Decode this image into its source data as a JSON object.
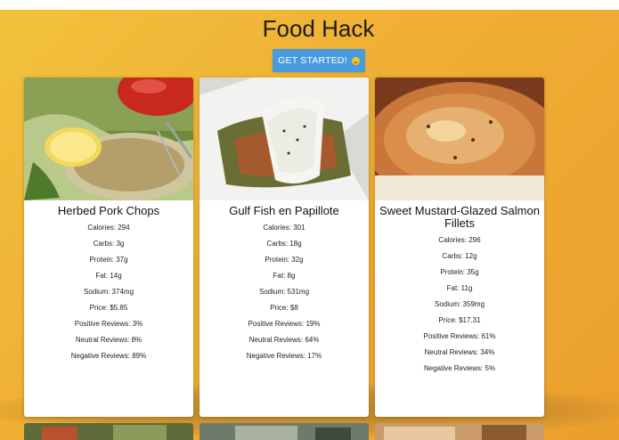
{
  "page": {
    "title": "Food Hack",
    "cta_label": "GET STARTED!",
    "cta_icon": "grinning-face-emoji"
  },
  "colors": {
    "background_start": "#f2c23e",
    "background_end": "#eb9f2e",
    "button": "#4a9bde",
    "card": "#ffffff"
  },
  "cards": [
    {
      "name": "Herbed Pork Chops",
      "image": "pork-chops-photo",
      "stats": [
        "Calories: 294",
        "Carbs: 3g",
        "Protein: 37g",
        "Fat: 14g",
        "Sodium: 374mg",
        "Price: $5.85",
        "Positive Reviews: 3%",
        "Neutral Reviews: 8%",
        "Negative Reviews: 89%"
      ]
    },
    {
      "name": "Gulf Fish en Papillote",
      "image": "fish-papillote-photo",
      "stats": [
        "Calories: 301",
        "Carbs: 18g",
        "Protein: 32g",
        "Fat: 8g",
        "Sodium: 531mg",
        "Price: $8",
        "Positive Reviews: 19%",
        "Neutral Reviews: 64%",
        "Negative Reviews: 17%"
      ]
    },
    {
      "name": "Sweet Mustard-Glazed Salmon Fillets",
      "image": "salmon-fillet-photo",
      "stats": [
        "Calories: 296",
        "Carbs: 12g",
        "Protein: 35g",
        "Fat: 11g",
        "Sodium: 359mg",
        "Price: $17.31",
        "Positive Reviews: 61%",
        "Neutral Reviews: 34%",
        "Negative Reviews: 5%"
      ]
    }
  ]
}
